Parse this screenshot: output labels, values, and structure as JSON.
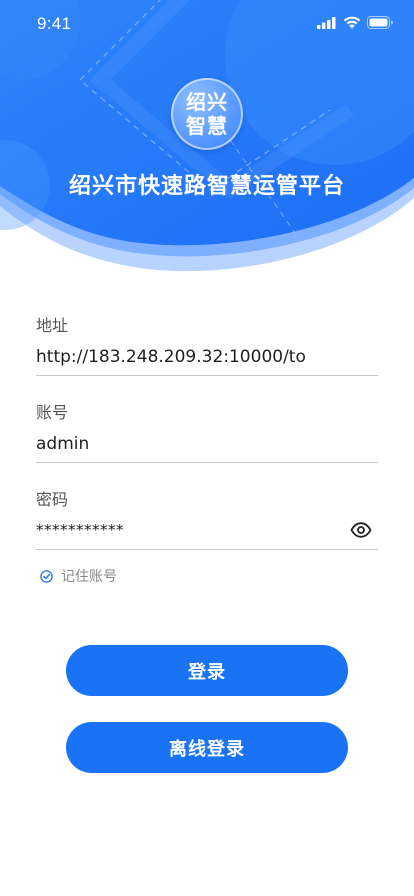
{
  "status_bar": {
    "time": "9:41"
  },
  "header": {
    "logo_lines": [
      "绍兴",
      "智慧"
    ],
    "title": "绍兴市快速路智慧运管平台"
  },
  "form": {
    "address": {
      "label": "地址",
      "value": "http://183.248.209.32:10000/to"
    },
    "account": {
      "label": "账号",
      "value": "admin"
    },
    "password": {
      "label": "密码",
      "value": "***********"
    },
    "remember": {
      "label": "记住账号",
      "checked": true
    }
  },
  "buttons": {
    "login": "登录",
    "offline_login": "离线登录"
  },
  "colors": {
    "primary": "#1a73f5",
    "header_blue": "#2a7cf8",
    "header_light": "#a9c8ff"
  }
}
